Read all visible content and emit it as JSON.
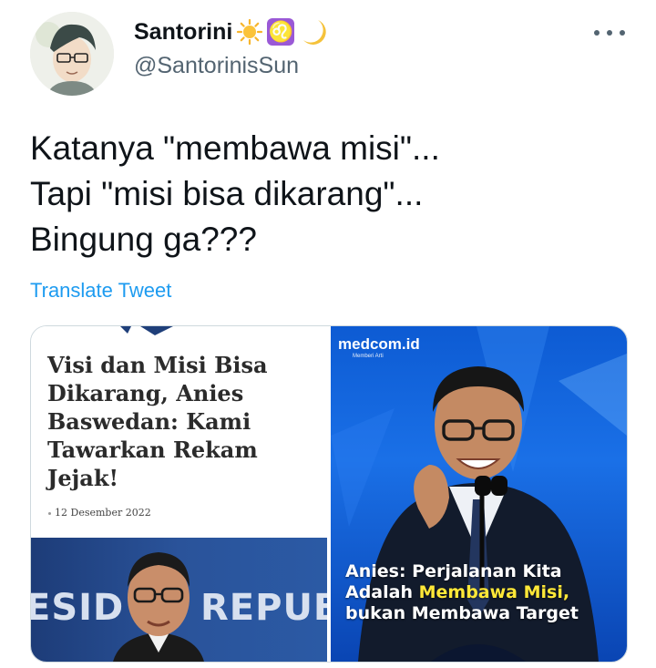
{
  "author": {
    "display_name": "Santorini",
    "handle": "@SantorinisSun",
    "name_emojis": [
      "sun-emoji",
      "leo-emoji",
      "crescent-moon-emoji"
    ]
  },
  "more_menu": {
    "icon": "more-horizontal-icon"
  },
  "tweet": {
    "lines": [
      "Katanya \"membawa misi\"...",
      "Tapi \"misi bisa dikarang\"...",
      "Bingung ga???"
    ],
    "translate_label": "Translate Tweet"
  },
  "media": {
    "left": {
      "headline": "Visi dan Misi Bisa Dikarang, Anies Baswedan: Kami Tawarkan Rekam Jejak!",
      "date": "12 Desember 2022",
      "photo_text_left": "ESID",
      "photo_text_right": "REPUBL"
    },
    "right": {
      "brand": "medcom.id",
      "brand_tagline": "Memberi Arti",
      "caption_line1": "Anies: Perjalanan Kita",
      "caption_line2_pre": "Adalah ",
      "caption_line2_highlight": "Membawa Misi,",
      "caption_line3": "bukan Membawa Target"
    }
  },
  "colors": {
    "accent": "#1d9bf0",
    "secondary_text": "#536471",
    "highlight_yellow": "#ffe838",
    "medcom_blue": "#1a70e7"
  }
}
